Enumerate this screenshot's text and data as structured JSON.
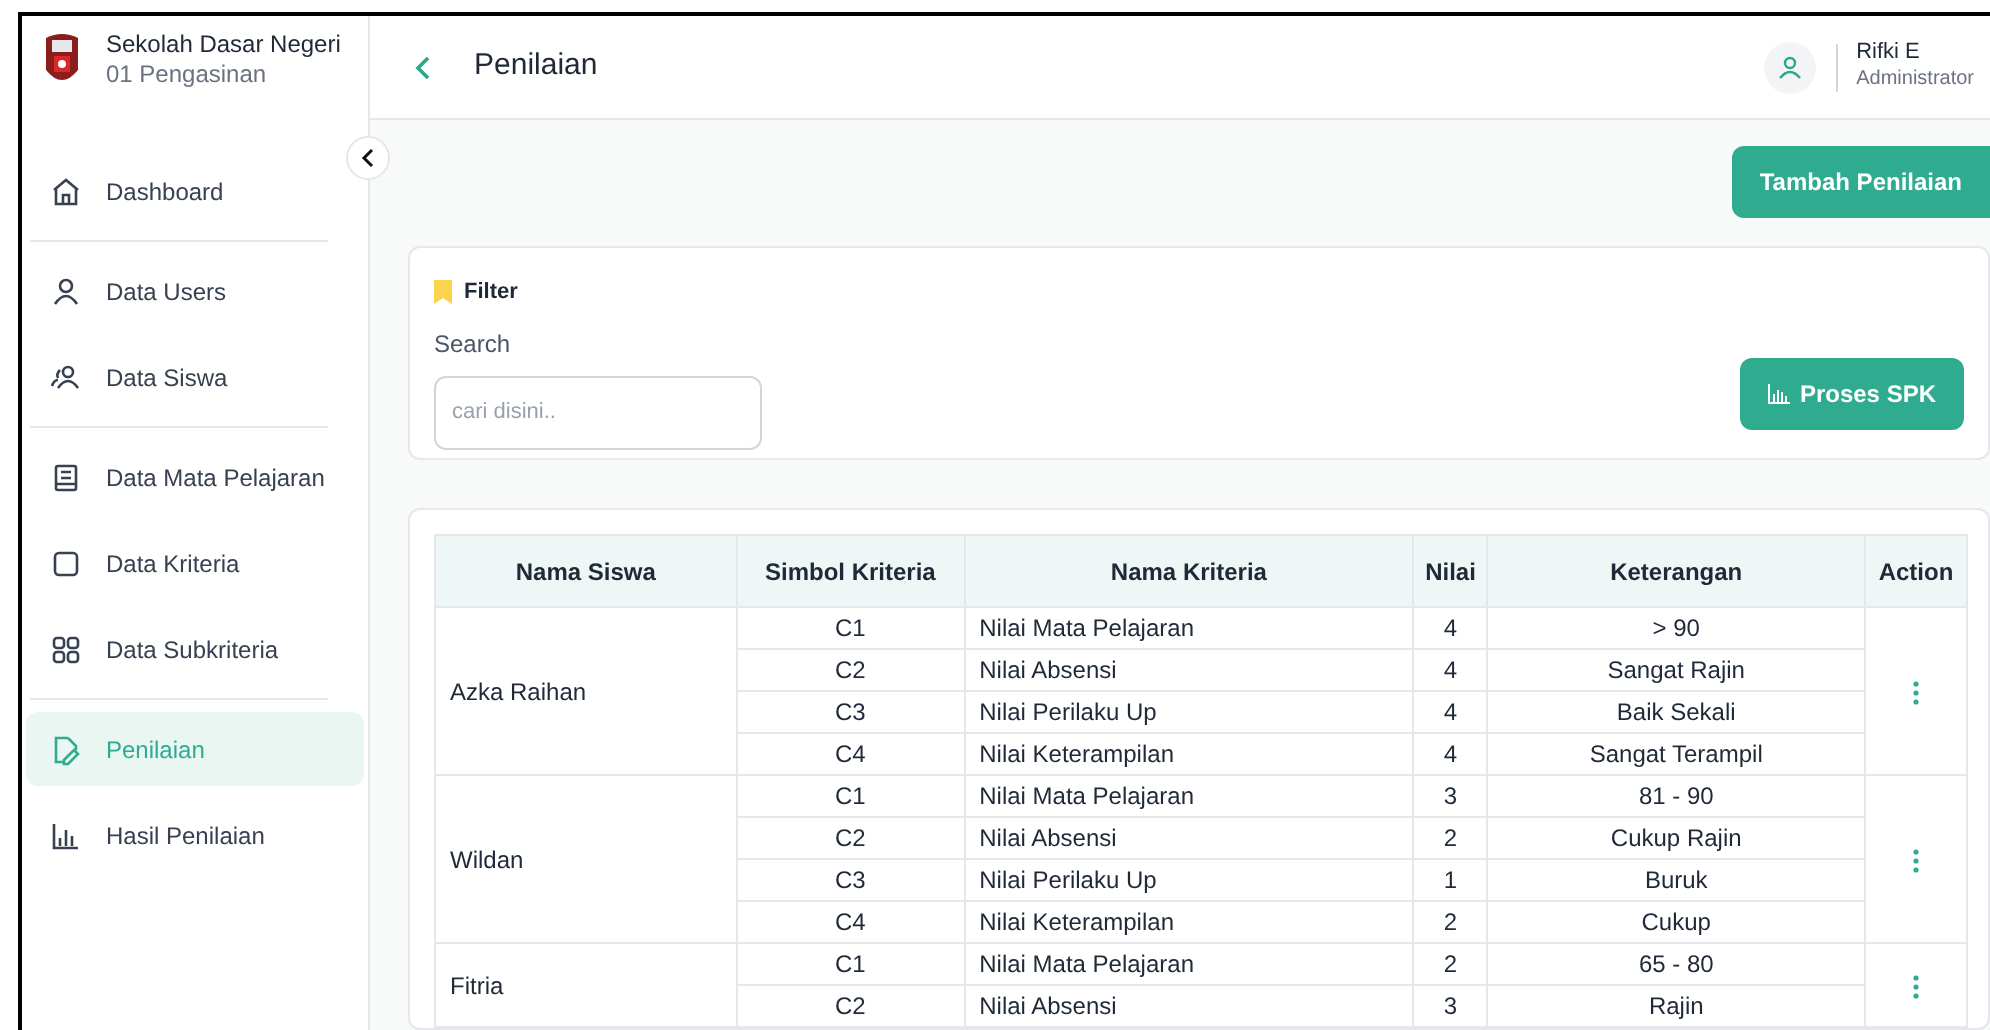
{
  "school": {
    "name": "Sekolah Dasar Negeri",
    "branch": "01 Pengasinan"
  },
  "sidebar": {
    "groups": [
      [
        {
          "label": "Dashboard",
          "selected": false
        }
      ],
      [
        {
          "label": "Data Users",
          "selected": false
        },
        {
          "label": "Data Siswa",
          "selected": false
        }
      ],
      [
        {
          "label": "Data Mata Pelajaran",
          "selected": false
        },
        {
          "label": "Data Kriteria",
          "selected": false
        },
        {
          "label": "Data Subkriteria",
          "selected": false
        }
      ],
      [
        {
          "label": "Penilaian",
          "selected": true
        },
        {
          "label": "Hasil Penilaian",
          "selected": false
        }
      ]
    ]
  },
  "header": {
    "title": "Penilaian",
    "user": {
      "name": "Rifki E",
      "role": "Administrator"
    }
  },
  "add_button": "Tambah Penilaian",
  "filter": {
    "title": "Filter",
    "search_label": "Search",
    "placeholder": "cari disini..",
    "process_button": "Proses SPK"
  },
  "table": {
    "columns": [
      "Nama Siswa",
      "Simbol Kriteria",
      "Nama Kriteria",
      "Nilai",
      "Keterangan",
      "Action"
    ],
    "students": [
      {
        "name": "Azka Raihan",
        "rows": [
          [
            "C1",
            "Nilai Mata Pelajaran",
            "4",
            "> 90"
          ],
          [
            "C2",
            "Nilai Absensi",
            "4",
            "Sangat Rajin"
          ],
          [
            "C3",
            "Nilai Perilaku Up",
            "4",
            "Baik Sekali"
          ],
          [
            "C4",
            "Nilai Keterampilan",
            "4",
            "Sangat Terampil"
          ]
        ]
      },
      {
        "name": "Wildan",
        "rows": [
          [
            "C1",
            "Nilai Mata Pelajaran",
            "3",
            "81 - 90"
          ],
          [
            "C2",
            "Nilai Absensi",
            "2",
            "Cukup Rajin"
          ],
          [
            "C3",
            "Nilai Perilaku Up",
            "1",
            "Buruk"
          ],
          [
            "C4",
            "Nilai Keterampilan",
            "2",
            "Cukup"
          ]
        ]
      },
      {
        "name": "Fitria",
        "rows": [
          [
            "C1",
            "Nilai Mata Pelajaran",
            "2",
            "65 - 80"
          ],
          [
            "C2",
            "Nilai Absensi",
            "3",
            "Rajin"
          ]
        ]
      }
    ]
  }
}
